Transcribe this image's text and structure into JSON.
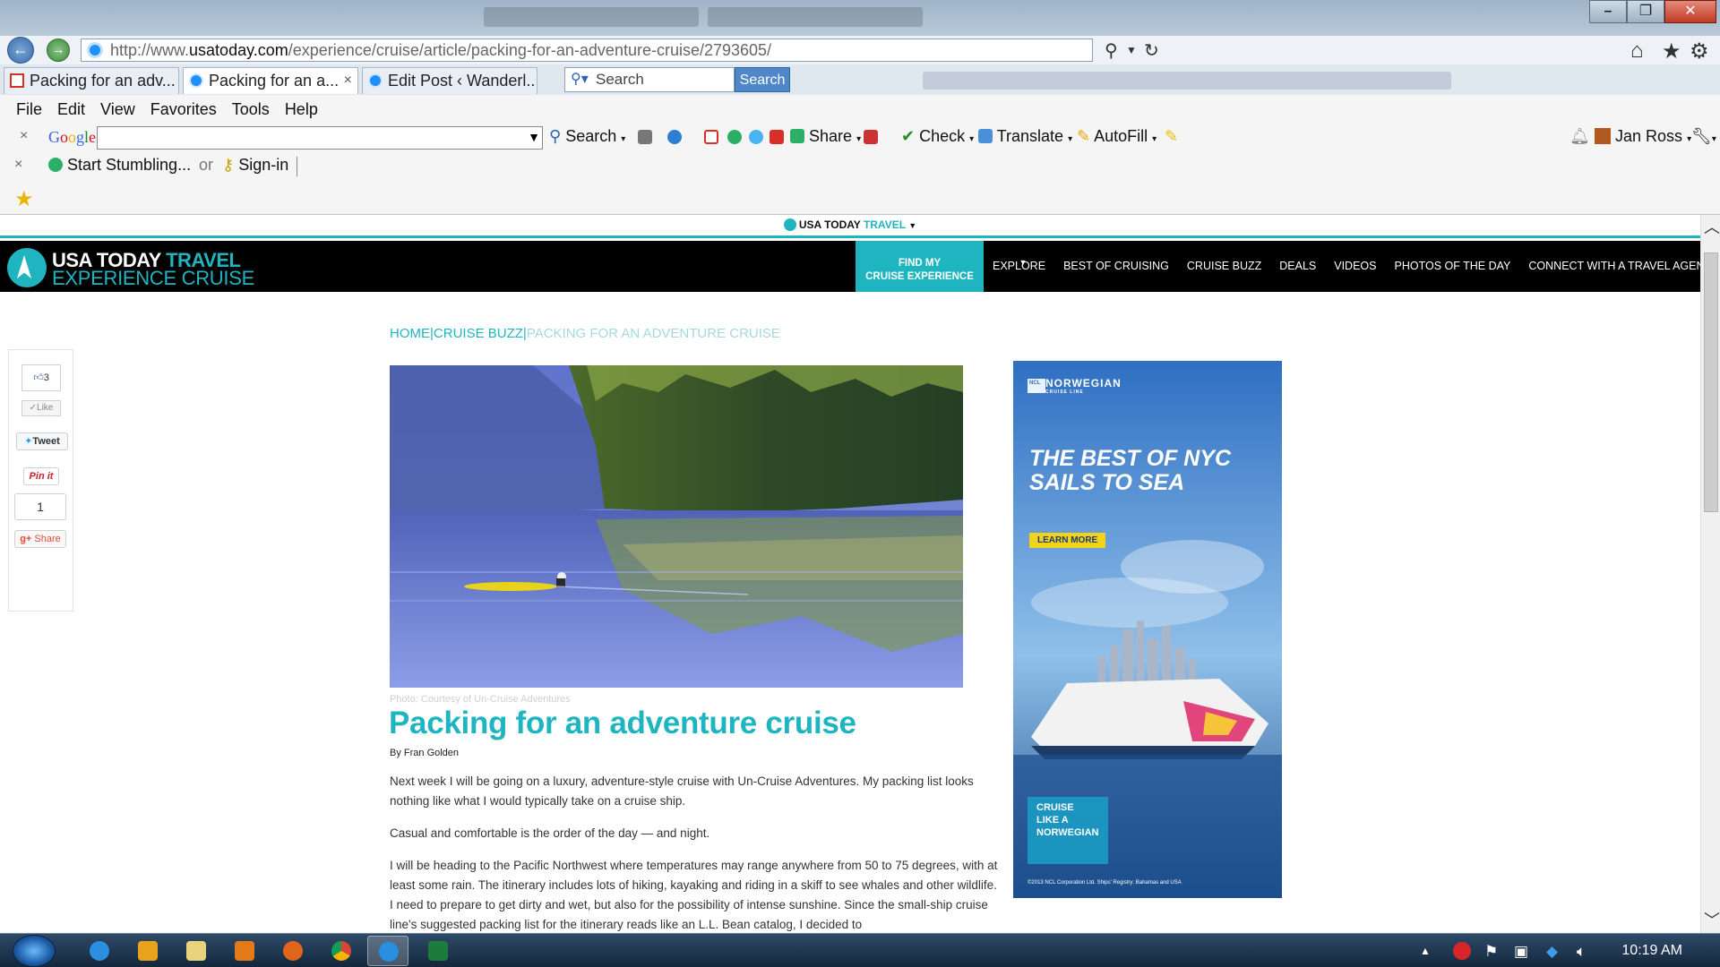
{
  "browser": {
    "address": {
      "prefix": "http://www.",
      "domain": "usatoday.com",
      "path": "/experience/cruise/article/packing-for-an-adventure-cruise/2793605/"
    },
    "tabs": [
      {
        "label": "Packing for an adv...",
        "icon": "gmail-icon"
      },
      {
        "label": "Packing for an a...",
        "icon": "ie-page-icon",
        "active": true,
        "close": "×"
      },
      {
        "label": "Edit Post ‹ Wanderl...",
        "icon": "ie-page-icon"
      }
    ],
    "tab_search": {
      "placeholder": "Search",
      "button": "Search"
    },
    "menu": [
      "File",
      "Edit",
      "View",
      "Favorites",
      "Tools",
      "Help"
    ],
    "google_toolbar": {
      "close": "×",
      "logo": "Google",
      "search_label": "Search",
      "share_label": "Share",
      "check_label": "Check",
      "translate_label": "Translate",
      "autofill_label": "AutoFill",
      "user": "Jan Ross"
    },
    "stumble_toolbar": {
      "close": "×",
      "start": "Start Stumbling...",
      "or": "or",
      "signin": "Sign-in"
    }
  },
  "site": {
    "topstrip": {
      "brand": "USA TODAY",
      "brand_accent": "TRAVEL",
      "caret": "▼"
    },
    "logo": {
      "line1": "USA TODAY",
      "line1_accent": "TRAVEL",
      "line2": "EXPERIENCE CRUISE"
    },
    "find_box": {
      "line1": "FIND MY",
      "line2": "CRUISE EXPERIENCE"
    },
    "nav": [
      "EXPLORE",
      "BEST OF CRUISING",
      "CRUISE BUZZ",
      "DEALS",
      "VIDEOS",
      "PHOTOS OF THE DAY",
      "CONNECT WITH A TRAVEL AGENT"
    ]
  },
  "breadcrumb": {
    "home": "HOME",
    "section": "CRUISE BUZZ",
    "current": "PACKING FOR AN ADVENTURE CRUISE",
    "sep": "|"
  },
  "social": {
    "likes": "3",
    "like_label": "Like",
    "tweet_label": "Tweet",
    "pin_label": "Pin it",
    "plus_count": "1",
    "share_label": "Share"
  },
  "article": {
    "photo_caption": "Photo: Courtesy of Un-Cruise Adventures",
    "title": "Packing for an adventure cruise",
    "byline": "By Fran Golden",
    "paragraphs": [
      "Next week I will be going on a luxury, adventure-style cruise with Un-Cruise Adventures. My packing list looks nothing like what I would typically take on a cruise ship.",
      "Casual and comfortable is the order of the day — and night.",
      "I will be heading to the Pacific Northwest where temperatures may range anywhere from 50 to 75 degrees, with at least some rain. The itinerary includes lots of hiking, kayaking and riding in a skiff to see whales and other wildlife. I need to prepare to get dirty and wet, but also for the possibility of intense sunshine. Since the small-ship cruise line's suggested packing list for the itinerary reads like an L.L. Bean catalog, I decided to"
    ]
  },
  "ad": {
    "brand": "NORWEGIAN",
    "brand_sub": "CRUISE LINE",
    "ncl": "NCL",
    "headline1": "THE BEST OF NYC",
    "headline2": "SAILS TO SEA",
    "cta": "LEARN MORE",
    "tag1": "CRUISE",
    "tag2": "LIKE A",
    "tag3": "NORWEGIAN",
    "legal": "©2013 NCL Corporation Ltd. Ships' Registry: Bahamas and USA"
  },
  "taskbar": {
    "clock": "10:19 AM",
    "apps": [
      "ie-icon",
      "outlook-icon",
      "explorer-icon",
      "media-player-icon",
      "firefox-icon",
      "chrome-icon",
      "ie-active-icon",
      "excel-icon"
    ]
  },
  "colors": {
    "accent": "#1fb5c0",
    "nav_bg": "#000000",
    "ad_blue": "#3b7fc4"
  }
}
